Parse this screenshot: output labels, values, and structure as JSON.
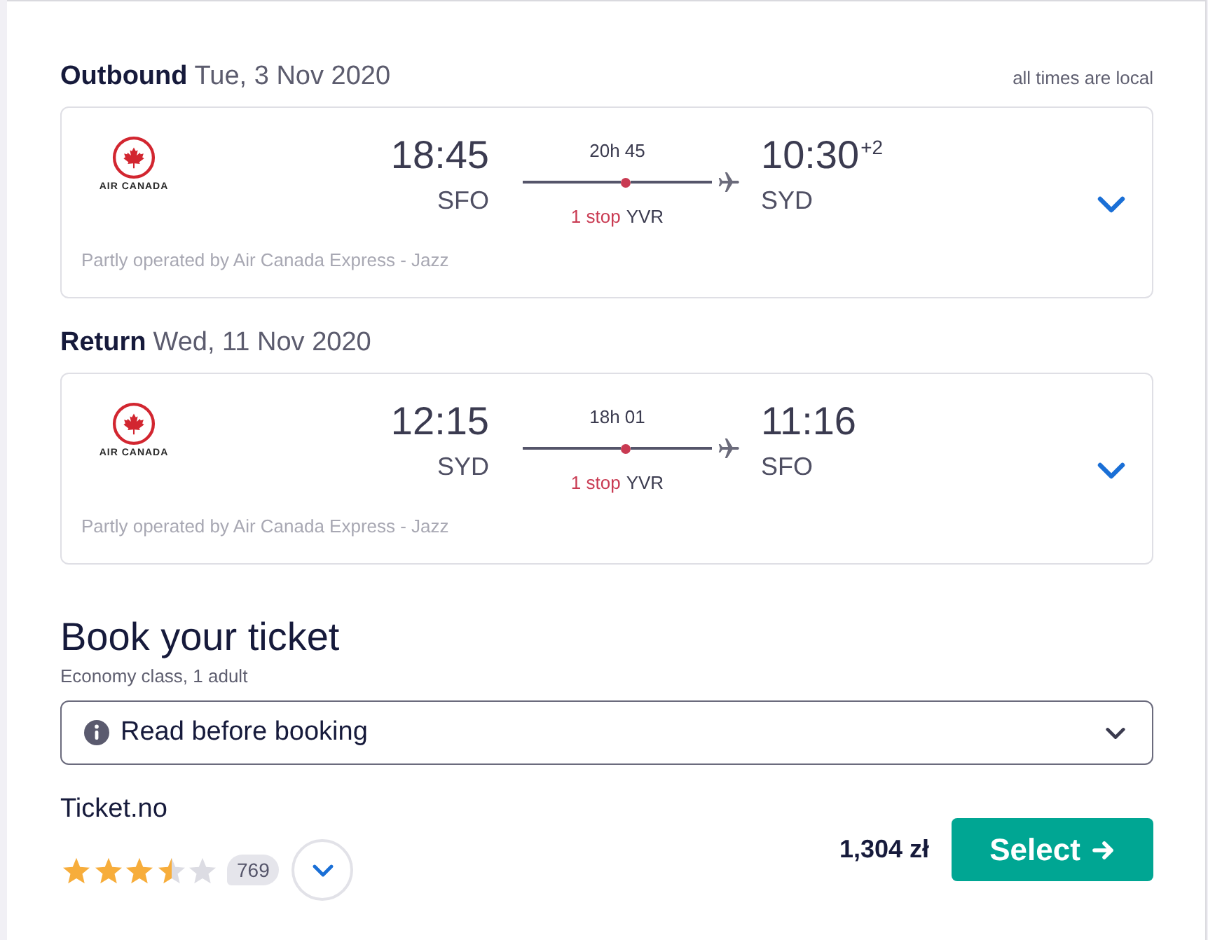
{
  "legs": [
    {
      "label": "Outbound",
      "date": "Tue, 3 Nov 2020",
      "note": "all times are local",
      "airline_logo_text": "AIR CANADA",
      "departure_time": "18:45",
      "departure_airport": "SFO",
      "duration": "20h 45",
      "stops": "1 stop",
      "stop_airport": "YVR",
      "arrival_time": "10:30$^{+2}$",
      "arrival_airport": "SYD",
      "operator_note": "Partly operated by Air Canada Express - Jazz"
    },
    {
      "label": "Return",
      "date": "Wed, 11 Nov 2020",
      "airline_logo_text": "AIR CANADA",
      "departure_time": "12:15",
      "departure_airport": "SYD",
      "duration": "18h 01",
      "stops": "1 stop",
      "stop_airport": "YVR",
      "arrival_time": "11:16",
      "arrival_airport": "SFO",
      "operator_note": "Partly operated by Air Canada Express - Jazz"
    }
  ],
  "booking": {
    "title": "Book your ticket",
    "subtitle": "Economy class, 1 adult",
    "notice": "Read before booking",
    "offer": {
      "provider": "Ticket.no",
      "stars": 3.5,
      "review_count": "769",
      "price": "1,304 zł",
      "select_label": "Select"
    }
  }
}
